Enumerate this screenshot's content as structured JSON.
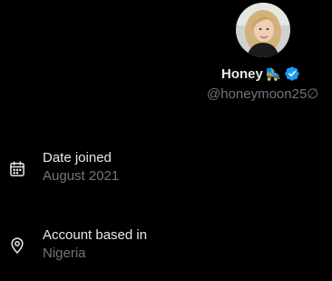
{
  "profile": {
    "display_name": "Honey",
    "emoji": "🛼",
    "handle": "@honeymoon25∅",
    "verified": true,
    "verified_color": "#1d9bf0"
  },
  "details": [
    {
      "title": "Date joined",
      "value": "August 2021",
      "icon": "calendar-icon"
    },
    {
      "title": "Account based in",
      "value": "Nigeria",
      "icon": "location-pin-icon"
    }
  ],
  "colors": {
    "background": "#000000",
    "primary_text": "#e7e9ea",
    "secondary_text": "#71767b"
  }
}
